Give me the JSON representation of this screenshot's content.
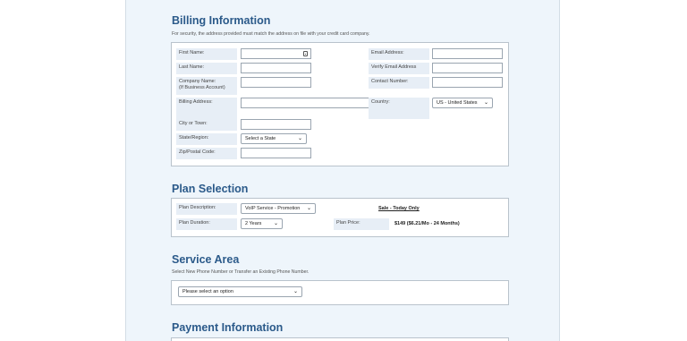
{
  "billing": {
    "title": "Billing Information",
    "note": "For security, the address provided must match the address on file with your credit card company.",
    "first_name": "First Name:",
    "last_name": "Last Name:",
    "company_name": "Company Name:",
    "company_sub": "(If Business Account)",
    "billing_address": "Billing Address:",
    "city": "City or Town:",
    "state": "State/Region:",
    "state_value": "Select a State",
    "zip": "Zip/Postal Code:",
    "email": "Email Address:",
    "verify_email": "Verify Email Address",
    "contact": "Contact Number:",
    "country": "Country:",
    "country_value": "US - United States"
  },
  "plan": {
    "title": "Plan Selection",
    "description_label": "Plan Description:",
    "description_value": "VoIP Service - Promotion",
    "sale_text": "Sale - Today Only",
    "duration_label": "Plan Duration:",
    "duration_value": "2 Years",
    "price_label": "Plan Price:",
    "price_value": "$149 ($6.21/Mo - 24 Months)"
  },
  "service": {
    "title": "Service Area",
    "note": "Select New Phone Number or Transfer an Existing Phone Number.",
    "option_value": "Please select an option"
  },
  "payment": {
    "title": "Payment Information"
  },
  "icons": {
    "chevron": "chevron-down-icon",
    "key": "password-key-icon"
  }
}
